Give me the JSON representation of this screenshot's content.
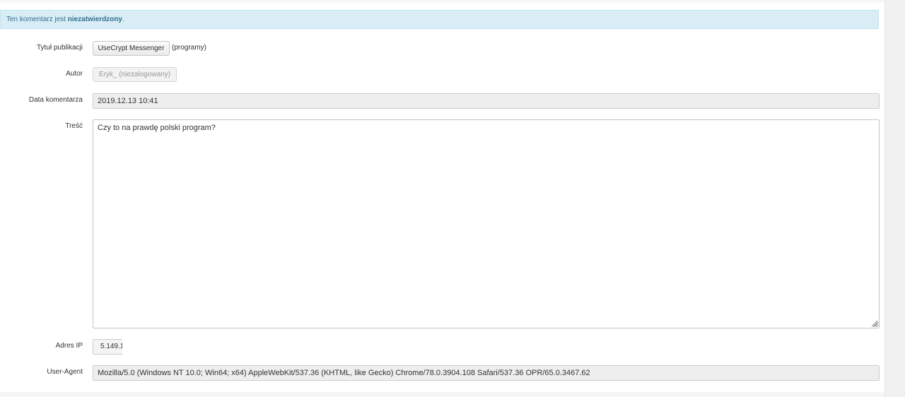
{
  "alert": {
    "prefix": "Ten komentarz jest ",
    "status": "niezatwierdzony",
    "suffix": "."
  },
  "fields": {
    "publication": {
      "label": "Tytuł publikacji",
      "button": "UseCrypt Messenger",
      "category": "(programy)"
    },
    "author": {
      "label": "Autor",
      "button": "Eryk_ (niezalogowany)"
    },
    "date": {
      "label": "Data komentarza",
      "value": "2019.12.13 10:41"
    },
    "content": {
      "label": "Treść",
      "value": "Czy to na prawdę polski program?"
    },
    "ip": {
      "label": "Adres IP",
      "value": "5.149.1"
    },
    "user_agent": {
      "label": "User-Agent",
      "value": "Mozilla/5.0 (Windows NT 10.0; Win64; x64) AppleWebKit/537.36 (KHTML, like Gecko) Chrome/78.0.3904.108 Safari/537.36 OPR/65.0.3467.62"
    }
  },
  "colors": {
    "alert_bg": "#d9edf7",
    "alert_text": "#31708f",
    "readonly_bg": "#eeeeee"
  }
}
